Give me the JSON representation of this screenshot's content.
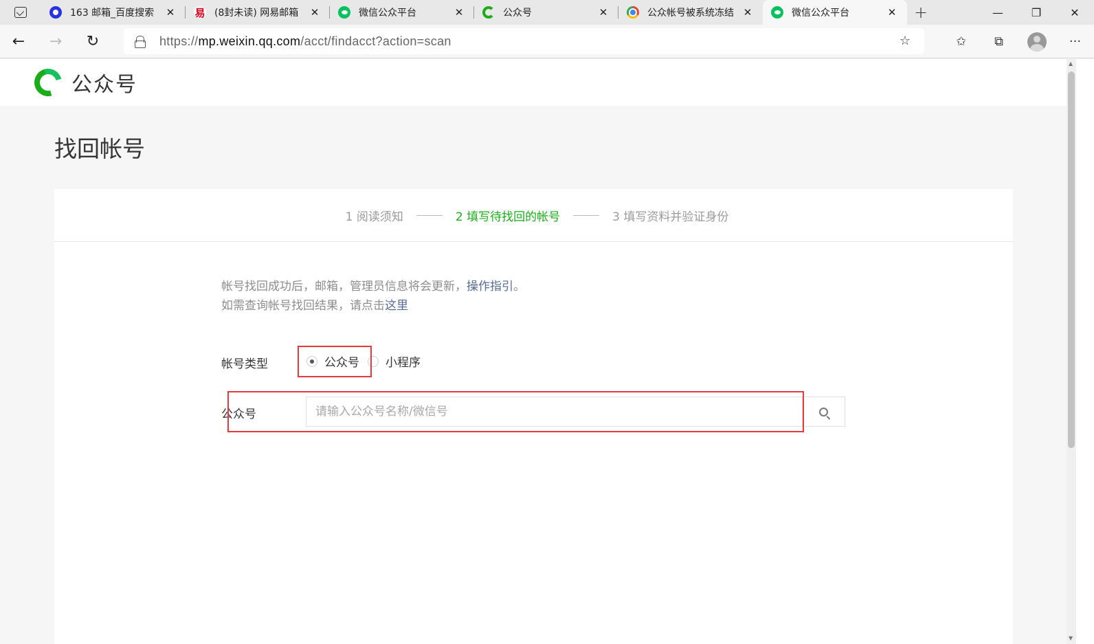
{
  "browser": {
    "tabs": [
      {
        "title": "163 邮箱_百度搜索",
        "icon": "baidu-paw-icon"
      },
      {
        "title": "(8封未读) 网易邮箱",
        "icon": "netease-163-icon"
      },
      {
        "title": "微信公众平台",
        "icon": "wechat-icon"
      },
      {
        "title": "公众号",
        "icon": "wechat-official-account-icon"
      },
      {
        "title": "公众帐号被系统冻结",
        "icon": "chrome-icon"
      },
      {
        "title": "微信公众平台",
        "icon": "wechat-icon",
        "active": true
      }
    ],
    "address_bar": {
      "scheme": "https://",
      "host": "mp.weixin.qq.com",
      "path": "/acct/findacct?action=scan"
    }
  },
  "header": {
    "logo_text": "公众号"
  },
  "page": {
    "title": "找回帐号",
    "steps": [
      {
        "label": "1 阅读须知",
        "active": false
      },
      {
        "label": "2 填写待找回的帐号",
        "active": true
      },
      {
        "label": "3 填写资料并验证身份",
        "active": false
      }
    ],
    "notice": {
      "line1": "帐号找回成功后，邮箱，管理员信息将会更新，",
      "line1_link": "操作指引",
      "line1_end": "。",
      "line2": "如需查询帐号找回结果，请点击",
      "line2_link": "这里"
    },
    "account_type": {
      "label": "帐号类型",
      "options": [
        "公众号",
        "小程序"
      ],
      "selected": "公众号"
    },
    "search": {
      "label": "公众号",
      "placeholder": "请输入公众号名称/微信号",
      "value": ""
    }
  },
  "colors": {
    "brand_green": "#1aad19",
    "link_blue": "#576b95",
    "highlight_red": "#e33b3b"
  }
}
